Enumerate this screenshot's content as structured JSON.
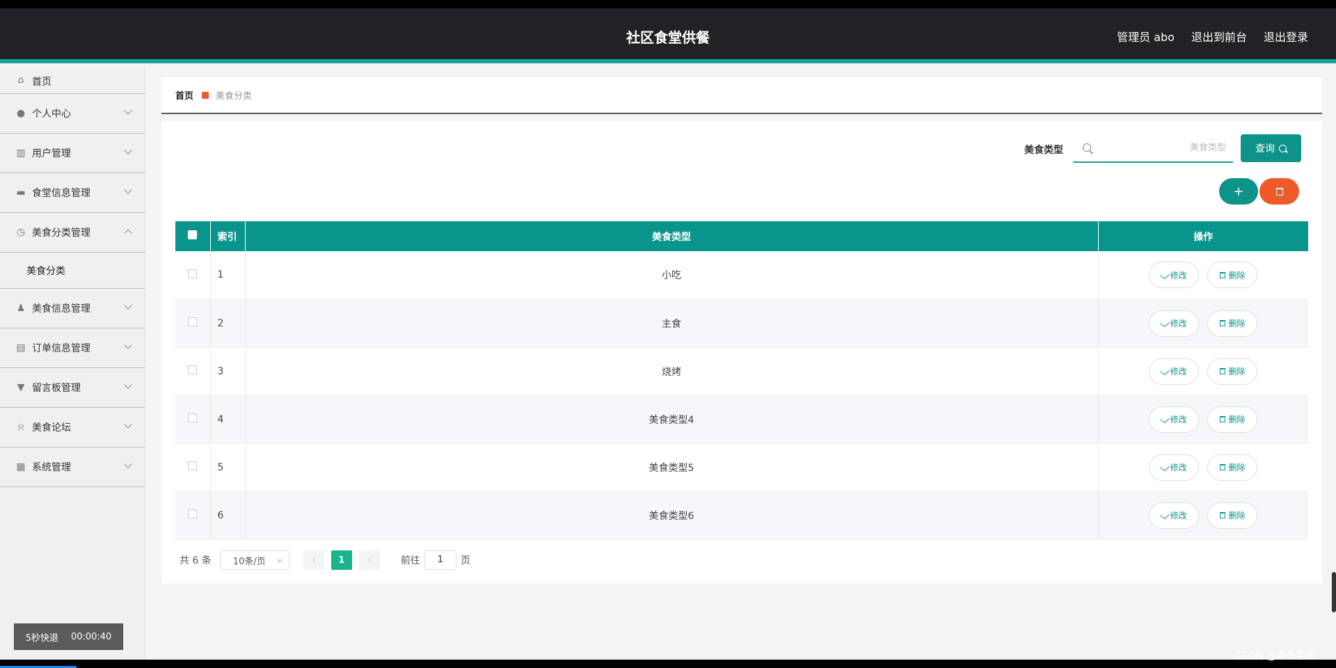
{
  "header": {
    "title": "社区食堂供餐",
    "nav": [
      "管理员 abo",
      "退出到前台",
      "退出登录"
    ]
  },
  "sidebar": {
    "items": [
      {
        "label": "首页",
        "icon": "home-icon"
      },
      {
        "label": "个人中心",
        "icon": "user-icon"
      },
      {
        "label": "用户管理",
        "icon": "chart-icon"
      },
      {
        "label": "食堂信息管理",
        "icon": "briefcase-icon"
      },
      {
        "label": "美食分类管理",
        "icon": "clock-icon",
        "expanded": true,
        "sub": "美食分类"
      },
      {
        "label": "美食信息管理",
        "icon": "person-icon"
      },
      {
        "label": "订单信息管理",
        "icon": "clipboard-icon"
      },
      {
        "label": "留言板管理",
        "icon": "pin-icon"
      },
      {
        "label": "美食论坛",
        "icon": "bell-icon"
      },
      {
        "label": "系统管理",
        "icon": "grid-icon"
      }
    ],
    "quit_label": "5秒快退",
    "quit_time": "00:00:40"
  },
  "breadcrumb": {
    "home": "首页",
    "current": "美食分类"
  },
  "search": {
    "label": "美食类型",
    "placeholder": "美食类型",
    "button": "查询"
  },
  "add_label": "+",
  "table": {
    "headers": [
      "索引",
      "美食类型",
      "操作"
    ],
    "rows": [
      {
        "index": "1",
        "type": "小吃"
      },
      {
        "index": "2",
        "type": "主食"
      },
      {
        "index": "3",
        "type": "烧烤"
      },
      {
        "index": "4",
        "type": "美食类型4"
      },
      {
        "index": "5",
        "type": "美食类型5"
      },
      {
        "index": "6",
        "type": "美食类型6"
      }
    ],
    "edit_label": "修改",
    "delete_label": "删除"
  },
  "pagination": {
    "total": "共 6 条",
    "page_size": "10条/页",
    "current_page": "1",
    "goto_prefix": "前往",
    "goto_value": "1",
    "goto_suffix": "页"
  },
  "watermark": "CSDN @卓杰学长",
  "colors": {
    "primary": "#0e938b",
    "danger": "#f05a28",
    "header_bg": "#222226"
  }
}
